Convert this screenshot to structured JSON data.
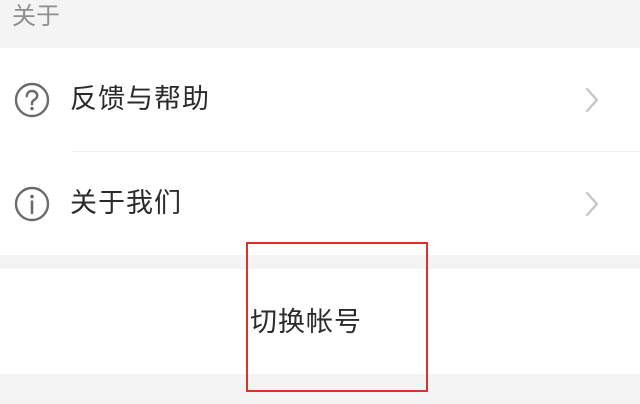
{
  "section": {
    "title": "关于"
  },
  "menu": {
    "items": [
      {
        "label": "反馈与帮助",
        "icon": "question-circle-icon"
      },
      {
        "label": "关于我们",
        "icon": "info-circle-icon"
      }
    ]
  },
  "account": {
    "switch_label": "切换帐号"
  },
  "colors": {
    "background": "#f4f4f4",
    "card": "#ffffff",
    "text": "#2b2b2b",
    "secondary_text": "#8e8e8e",
    "icon": "#6b6b6b",
    "chevron": "#c4c4c4",
    "highlight": "#e0302a"
  }
}
